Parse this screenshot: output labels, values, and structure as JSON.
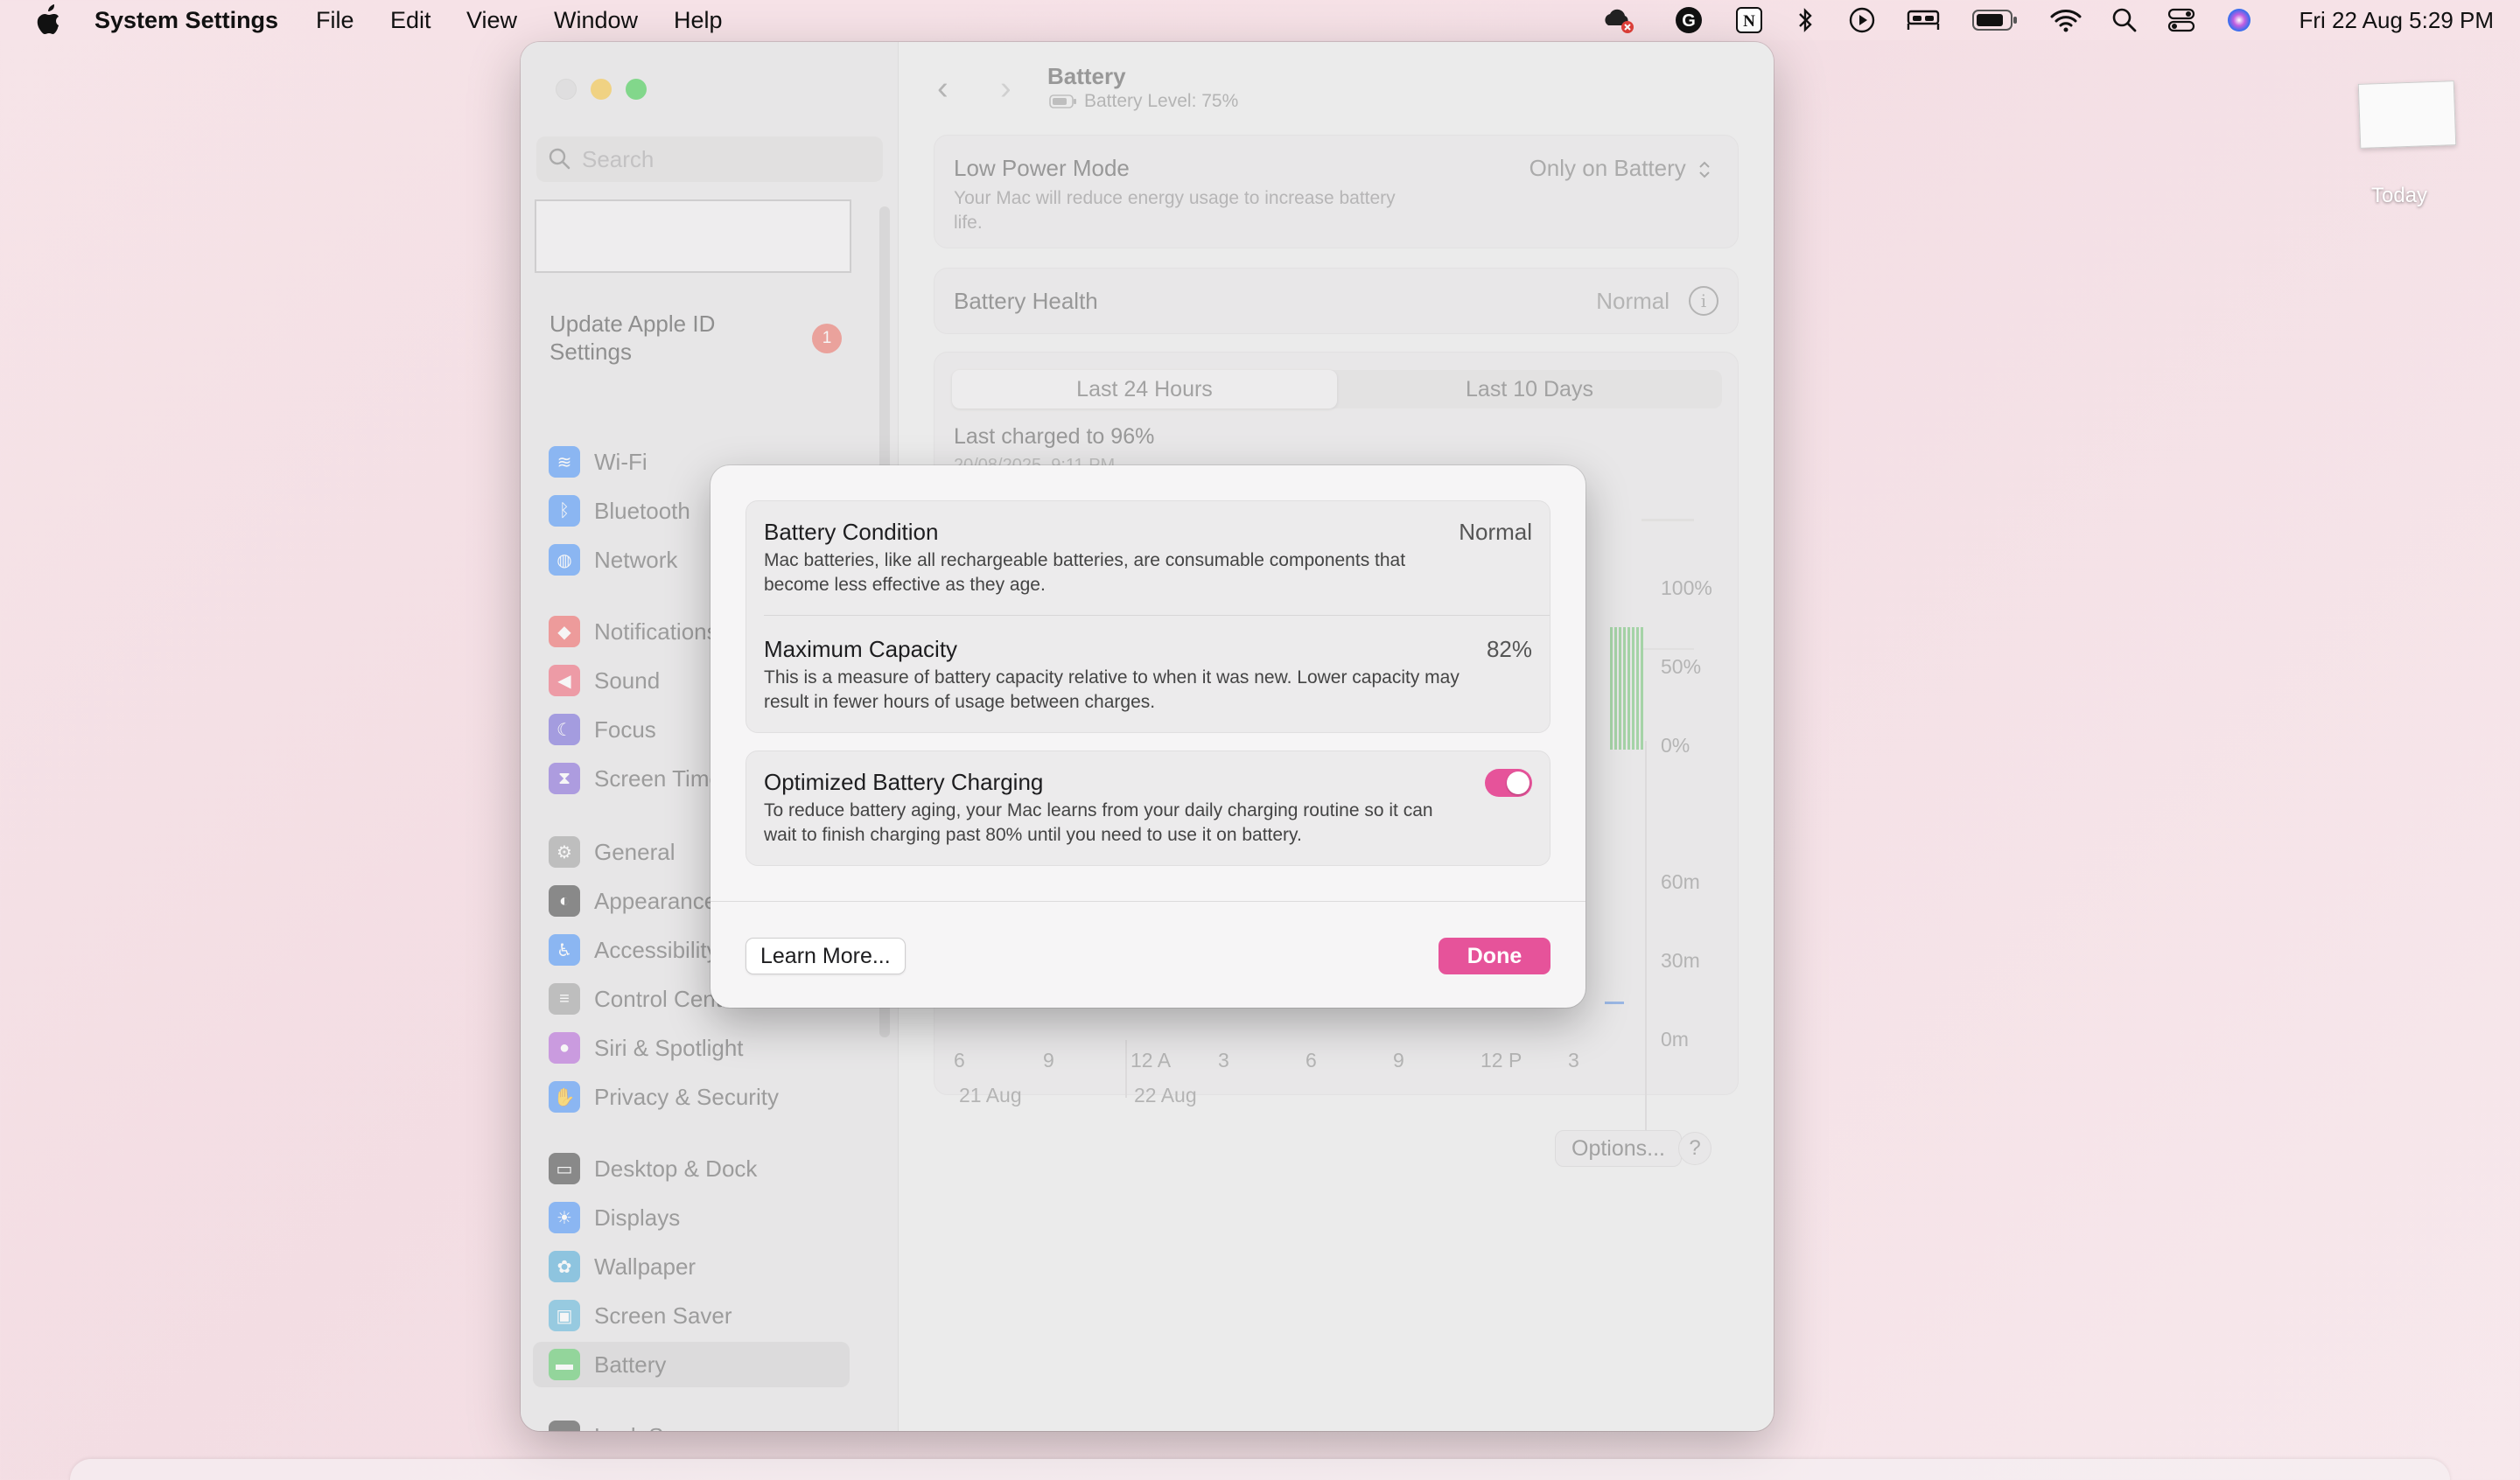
{
  "menubar": {
    "app_name": "System Settings",
    "menus": [
      "File",
      "Edit",
      "View",
      "Window",
      "Help"
    ],
    "clock": "Fri 22 Aug  5:29 PM"
  },
  "sidebar": {
    "search_placeholder": "Search",
    "apple_id_label": "Update Apple ID Settings",
    "apple_id_badge": "1",
    "items": [
      {
        "label": "Wi-Fi",
        "icon": "wifi-icon",
        "color": "#3d8af7"
      },
      {
        "label": "Bluetooth",
        "icon": "bluetooth-icon",
        "color": "#3d8af7"
      },
      {
        "label": "Network",
        "icon": "globe-icon",
        "color": "#3d8af7"
      },
      {
        "label": "Notifications",
        "icon": "bell-icon",
        "color": "#ee5a5a"
      },
      {
        "label": "Sound",
        "icon": "speaker-icon",
        "color": "#ee5a6e"
      },
      {
        "label": "Focus",
        "icon": "moon-icon",
        "color": "#6a5bd6"
      },
      {
        "label": "Screen Time",
        "icon": "hourglass-icon",
        "color": "#7b5bd6"
      },
      {
        "label": "General",
        "icon": "gear-icon",
        "color": "#9a999a"
      },
      {
        "label": "Appearance",
        "icon": "appearance-icon",
        "color": "#3a3a3a"
      },
      {
        "label": "Accessibility",
        "icon": "accessibility-icon",
        "color": "#3d8af7"
      },
      {
        "label": "Control Centre",
        "icon": "control-centre-icon",
        "color": "#9a999a"
      },
      {
        "label": "Siri & Spotlight",
        "icon": "siri-icon",
        "color": "#b05ad6"
      },
      {
        "label": "Privacy & Security",
        "icon": "hand-icon",
        "color": "#3d8af7"
      },
      {
        "label": "Desktop & Dock",
        "icon": "dock-icon",
        "color": "#3a3a3a"
      },
      {
        "label": "Displays",
        "icon": "sun-icon",
        "color": "#3d8af7"
      },
      {
        "label": "Wallpaper",
        "icon": "flower-icon",
        "color": "#42a5d6"
      },
      {
        "label": "Screen Saver",
        "icon": "screensaver-icon",
        "color": "#52b0d8"
      },
      {
        "label": "Battery",
        "icon": "battery-icon",
        "color": "#4cc35a"
      },
      {
        "label": "Lock Screen",
        "icon": "lock-icon",
        "color": "#3a3a3a"
      }
    ]
  },
  "main": {
    "title": "Battery",
    "subtitle": "Battery Level: 75%",
    "low_power": {
      "title": "Low Power Mode",
      "desc": "Your Mac will reduce energy usage to increase battery life.",
      "value": "Only on Battery"
    },
    "battery_health": {
      "title": "Battery Health",
      "value": "Normal"
    },
    "tabs": [
      "Last 24 Hours",
      "Last 10 Days"
    ],
    "last_charged": "Last charged to 96%",
    "last_charged_date": "20/08/2025, 9:11 PM",
    "chart": {
      "y_level_labels": [
        "100%",
        "50%",
        "0%"
      ],
      "y_usage_labels": [
        "60m",
        "30m",
        "0m"
      ],
      "x_labels": [
        "6",
        "9",
        "12 A",
        "3",
        "6",
        "9",
        "12 P",
        "3"
      ],
      "date_labels": [
        "21 Aug",
        "22 Aug"
      ]
    },
    "options_label": "Options...",
    "help_label": "?"
  },
  "sheet": {
    "condition": {
      "title": "Battery Condition",
      "value": "Normal",
      "desc": "Mac batteries, like all rechargeable batteries, are consumable components that become less effective as they age."
    },
    "capacity": {
      "title": "Maximum Capacity",
      "value": "82%",
      "desc": "This is a measure of battery capacity relative to when it was new. Lower capacity may result in fewer hours of usage between charges."
    },
    "optimized": {
      "title": "Optimized Battery Charging",
      "enabled": true,
      "desc": "To reduce battery aging, your Mac learns from your daily charging routine so it can wait to finish charging past 80% until you need to use it on battery."
    },
    "learn_more_label": "Learn More...",
    "done_label": "Done"
  },
  "desktop": {
    "widget_label": "Today"
  },
  "colors": {
    "accent": "#e6539a",
    "battery_green": "#5cc466"
  }
}
